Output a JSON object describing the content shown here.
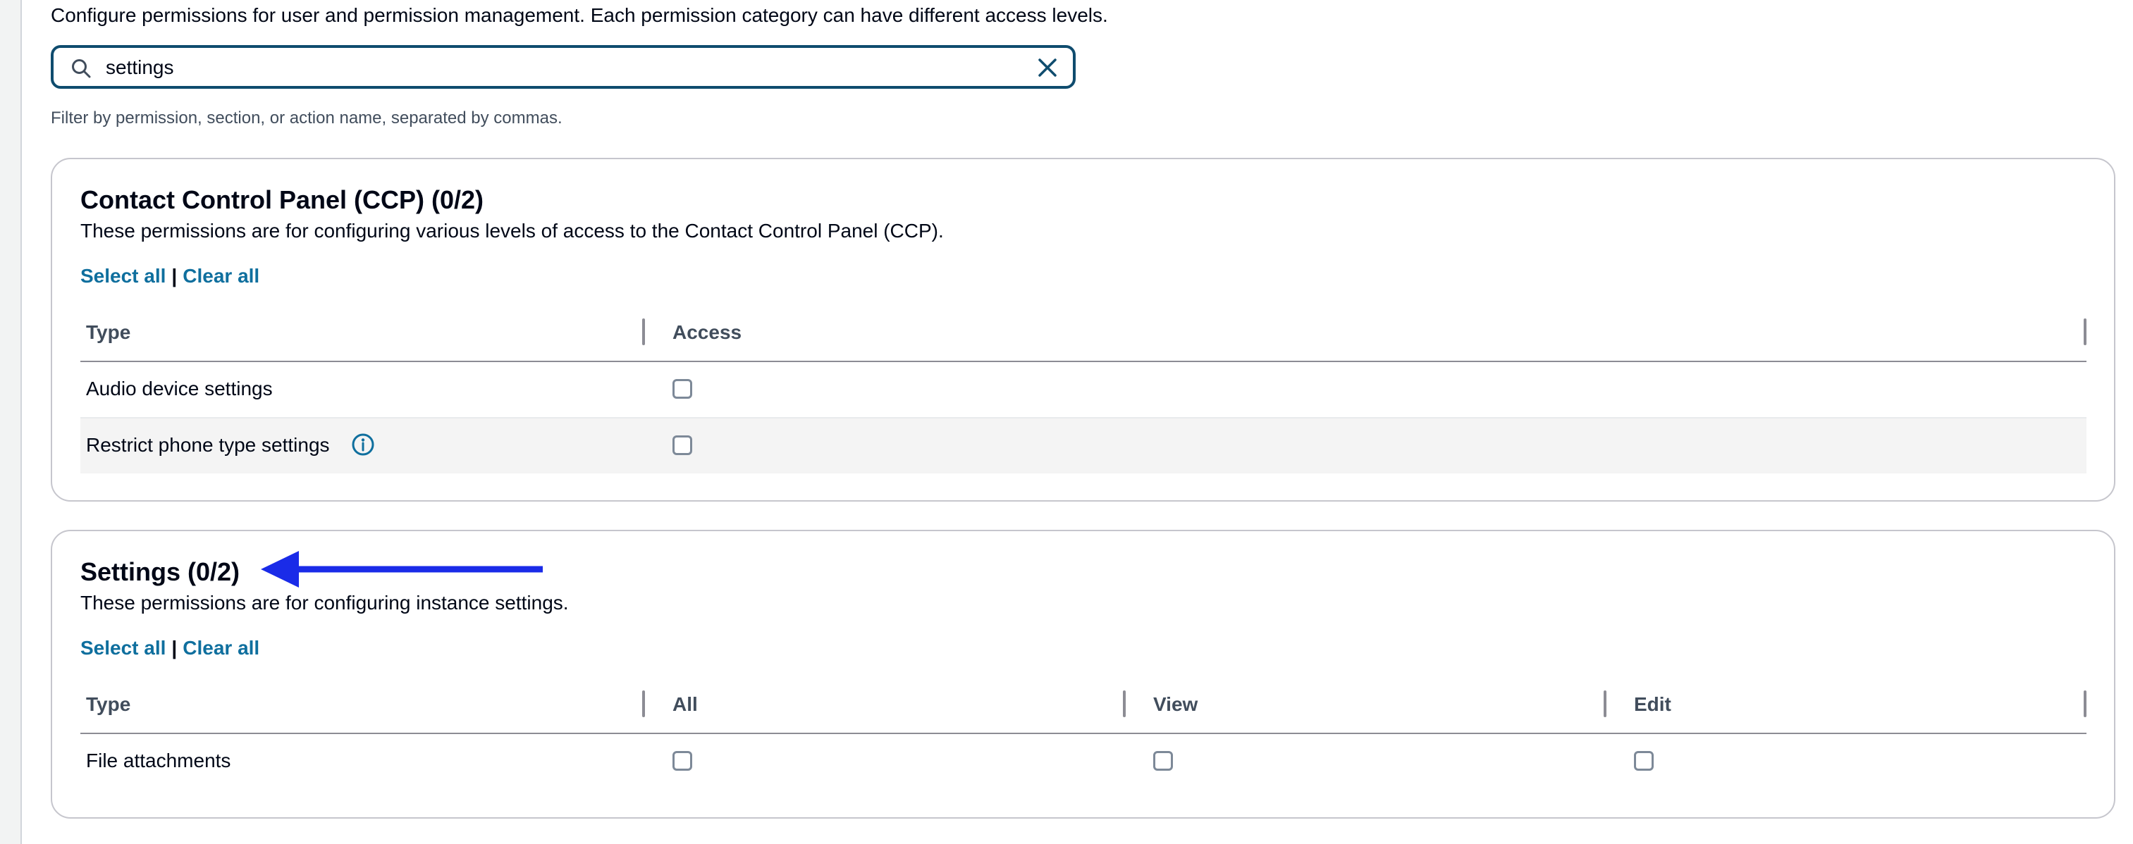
{
  "intro": "Configure permissions for user and permission management. Each permission category can have different access levels.",
  "search": {
    "value": "settings",
    "placeholder": "",
    "help": "Filter by permission, section, or action name, separated by commas."
  },
  "icons": {
    "search": "search-icon",
    "clear": "close-icon",
    "info": "info-icon",
    "annotation": "arrow-left-icon"
  },
  "colors": {
    "link": "#0f6f9e",
    "focus_border": "#0f4c6e",
    "annotation_arrow": "#1a2be8"
  },
  "sections": [
    {
      "title": "Contact Control Panel (CCP) (0/2)",
      "description": "These permissions are for configuring various levels of access to the Contact Control Panel (CCP).",
      "select_all": "Select all",
      "separator": "|",
      "clear_all": "Clear all",
      "columns": [
        "Type",
        "Access"
      ],
      "rows": [
        {
          "type": "Audio device settings",
          "checked": [
            false
          ],
          "has_info": false
        },
        {
          "type": "Restrict phone type settings",
          "checked": [
            false
          ],
          "has_info": true
        }
      ]
    },
    {
      "title": "Settings (0/2)",
      "description": "These permissions are for configuring instance settings.",
      "select_all": "Select all",
      "separator": "|",
      "clear_all": "Clear all",
      "columns": [
        "Type",
        "All",
        "View",
        "Edit"
      ],
      "rows": [
        {
          "type": "File attachments",
          "checked": [
            false,
            false,
            false
          ],
          "has_info": false
        }
      ]
    }
  ]
}
